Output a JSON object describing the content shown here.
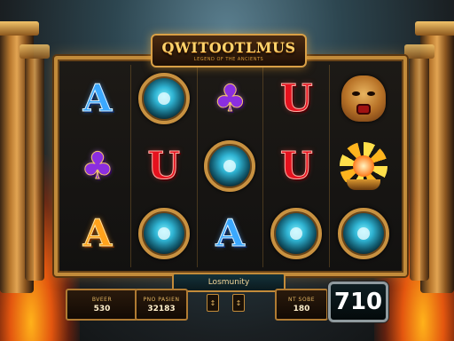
{
  "game": {
    "title": "QWITOOTLMUS",
    "subtitle": "LEGEND OF THE ANCIENTS"
  },
  "reels": [
    [
      {
        "symbol": "letter-a",
        "glyph": "A",
        "color": "blue"
      },
      {
        "symbol": "medallion",
        "glyph": ""
      },
      {
        "symbol": "club",
        "glyph": "♣"
      },
      {
        "symbol": "letter-u",
        "glyph": "U",
        "color": "red"
      },
      {
        "symbol": "mask",
        "glyph": ""
      }
    ],
    [
      {
        "symbol": "club",
        "glyph": "♣"
      },
      {
        "symbol": "letter-u",
        "glyph": "U",
        "color": "red"
      },
      {
        "symbol": "medallion",
        "glyph": ""
      },
      {
        "symbol": "letter-u",
        "glyph": "U",
        "color": "red"
      },
      {
        "symbol": "sun",
        "glyph": ""
      }
    ],
    [
      {
        "symbol": "letter-a",
        "glyph": "A",
        "color": "gold"
      },
      {
        "symbol": "medallion",
        "glyph": ""
      },
      {
        "symbol": "letter-a",
        "glyph": "A",
        "color": "blue"
      },
      {
        "symbol": "medallion",
        "glyph": ""
      },
      {
        "symbol": "medallion",
        "glyph": ""
      }
    ]
  ],
  "bottom": {
    "center_label": "Losmunity",
    "panel1": {
      "label": "BVEER",
      "value": "530"
    },
    "panel2": {
      "label": "PNO PASIEN",
      "value": "32183"
    },
    "panel3": {
      "label": "NT SOBE",
      "value": "180"
    },
    "ctrl_left": "↕",
    "ctrl_right": "↕",
    "spin_value": "710"
  }
}
